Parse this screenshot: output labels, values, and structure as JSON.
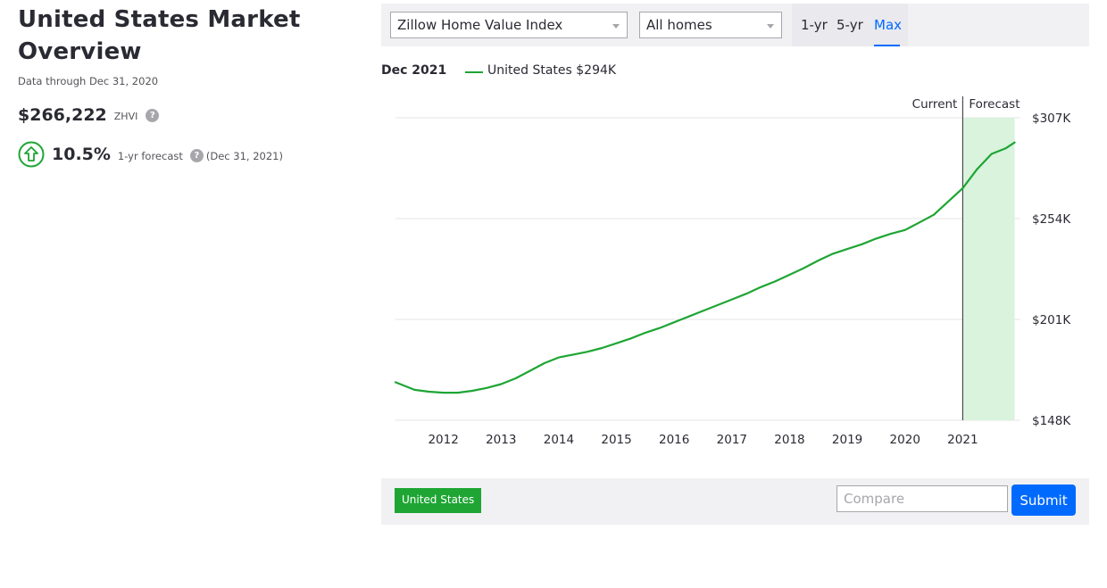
{
  "overview": {
    "title_line1": "United States Market",
    "title_line2": "Overview",
    "data_through": "Data through Dec 31, 2020",
    "zhvi_value": "$266,222",
    "zhvi_label": "ZHVI",
    "help_glyph": "?",
    "forecast_pct": "10.5%",
    "forecast_label": "1-yr forecast",
    "forecast_date": "(Dec 31, 2021)",
    "forecast_icon": "up-arrow-circle-icon"
  },
  "controls": {
    "index_select": "Zillow Home Value Index",
    "home_type_select": "All homes",
    "ranges": [
      "1-yr",
      "5-yr",
      "Max"
    ],
    "active_range": "Max"
  },
  "legend": {
    "date": "Dec 2021",
    "series_label": "United States $294K"
  },
  "colors": {
    "series": "#1ea534",
    "forecast_band": "#d9f3dd",
    "accent": "#006aff"
  },
  "chart_data": {
    "type": "line",
    "markers": {
      "current": "Current",
      "forecast": "Forecast"
    },
    "x_ticks": [
      "2012",
      "2013",
      "2014",
      "2015",
      "2016",
      "2017",
      "2018",
      "2019",
      "2020",
      "2021"
    ],
    "y_ticks": [
      "$148K",
      "$201K",
      "$254K",
      "$307K"
    ],
    "y_tick_values": [
      148,
      201,
      254,
      307
    ],
    "ylim": [
      148,
      307
    ],
    "xlim": [
      2011.17,
      2022.0
    ],
    "current_x": 2021.0,
    "forecast_end_x": 2021.9,
    "grid": true,
    "series": [
      {
        "name": "United States",
        "x": [
          2011.17,
          2011.5,
          2011.75,
          2012.0,
          2012.25,
          2012.5,
          2012.75,
          2013.0,
          2013.25,
          2013.5,
          2013.75,
          2014.0,
          2014.25,
          2014.5,
          2014.75,
          2015.0,
          2015.25,
          2015.5,
          2015.75,
          2016.0,
          2016.25,
          2016.5,
          2016.75,
          2017.0,
          2017.25,
          2017.5,
          2017.75,
          2018.0,
          2018.25,
          2018.5,
          2018.75,
          2019.0,
          2019.25,
          2019.5,
          2019.75,
          2020.0,
          2020.25,
          2020.5,
          2020.75,
          2021.0,
          2021.25,
          2021.5,
          2021.75,
          2021.9
        ],
        "values": [
          168,
          164,
          163,
          162.5,
          162.5,
          163.5,
          165,
          167,
          170,
          174,
          178,
          181,
          182.5,
          184,
          186,
          188.5,
          191,
          194,
          196.5,
          199.5,
          202.5,
          205.5,
          208.5,
          211.5,
          214.5,
          218,
          221,
          224.5,
          228,
          232,
          235.5,
          238,
          240.5,
          243.5,
          246,
          248,
          252,
          256,
          263,
          270,
          280,
          288,
          291,
          294
        ]
      }
    ]
  },
  "compare": {
    "chip": "United States",
    "placeholder": "Compare",
    "submit": "Submit"
  }
}
